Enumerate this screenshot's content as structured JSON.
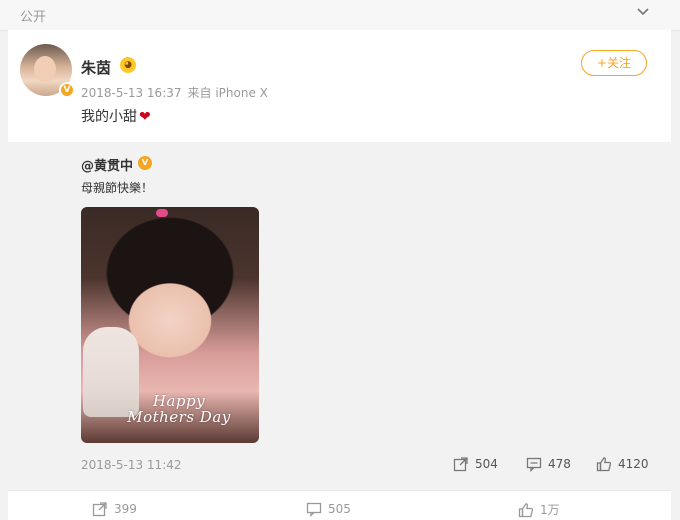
{
  "topbar": {
    "visibility_label": "公开",
    "expand_icon": "chevron-down-icon"
  },
  "post": {
    "username": "朱茵",
    "timestamp": "2018-5-13 16:37",
    "source": "来自 iPhone X",
    "text": "我的小甜",
    "text_emoji": "❤",
    "follow_label": "+关注"
  },
  "repost": {
    "author": "@黄贯中",
    "text": "母親節快樂！",
    "photo_caption": "Happy Mothers Day",
    "timestamp": "2018-5-13 11:42",
    "stats": {
      "shares": "504",
      "comments": "478",
      "likes": "4120"
    }
  },
  "bottom_bar": {
    "shares": "399",
    "comments": "505",
    "likes": "1万"
  },
  "colors": {
    "accent": "#f5a623",
    "heart": "#d0021b",
    "muted": "#9a9a9a"
  }
}
